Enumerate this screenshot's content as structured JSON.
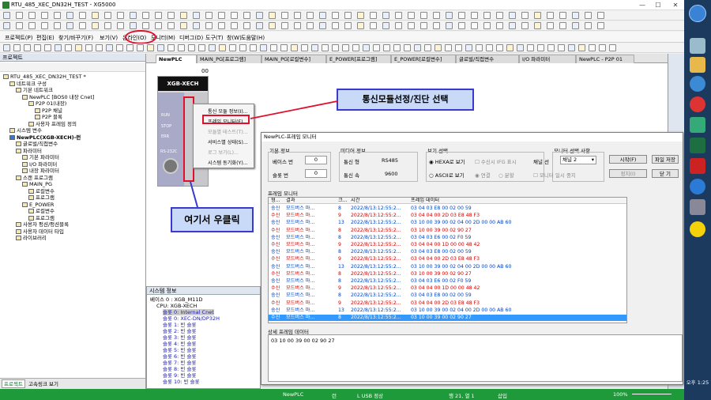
{
  "window": {
    "title": "RTU_485_XEC_DN32H_TEST - XG5000",
    "min": "—",
    "max": "☐",
    "close": "✕"
  },
  "menu": {
    "items": [
      "프로젝트(P)",
      "편집(E)",
      "찾기/바꾸기(F)",
      "보기(V)",
      "온라인(O)",
      "모니터(M)",
      "디버그(D)",
      "도구(T)",
      "창(W)",
      "도움말(H)"
    ]
  },
  "project_panel": {
    "header": "프로젝트",
    "tree": [
      "RTU_485_XEC_DN32H_TEST *",
      "네트워크 구성",
      "기본 네트워크",
      "NewPLC [BOS0 내장 Cnet]",
      "P2P 01(내장)",
      "P2P 채널",
      "P2P 블록",
      "사용자 프레임 정의",
      "시스템 변수",
      "NewPLC(XGB-XECH)-런",
      "글로벌/직접변수",
      "파라미터",
      "기본 파라미터",
      "I/O 파라미터",
      "내장 파라미터",
      "스캔 프로그램",
      "MAIN_PG",
      "로컬변수",
      "프로그램",
      "E_POWER",
      "로컬변수",
      "프로그램",
      "사용자 펑션/펑션블록",
      "사용자 데이터 타입",
      "라이브러리"
    ]
  },
  "bottom_tabs": [
    "프로젝트",
    "고속링크 보기"
  ],
  "editor_tabs": [
    "NewPLC",
    "MAIN_PG[프로그램]",
    "MAIN_PG[로컬변수]",
    "E_POWER[프로그램]",
    "E_POWER[로컬변수]",
    "글로벌/직접변수",
    "I/O 파라미터",
    "NewPLC - P2P 01"
  ],
  "plc": {
    "brand": "XGB-XECH",
    "slot": "00",
    "leds": [
      "RUN",
      "STOP",
      "ERR"
    ],
    "port": "RS-232C"
  },
  "context_menu": [
    "통신 모듈 정보(I)...",
    "프레임 모니터(F)...",
    "모듈별 테스트(T)...",
    "서비스별 상태(S)...",
    "로그 보기(L)...",
    "시스템 동기화(Y)..."
  ],
  "callouts": {
    "top": "통신모듈선정/진단 선택",
    "bottom": "여기서 우클릭"
  },
  "sysinfo": {
    "header": "시스템 정보",
    "items": [
      "베이스 0 : XGB_M11D",
      "CPU: XGB-XECH",
      "슬롯 0: Internal Cnet",
      "슬롯 0: XEC-DN/DP32H",
      "슬롯 1: 빈 슬롯",
      "슬롯 2: 빈 슬롯",
      "슬롯 3: 빈 슬롯",
      "슬롯 4: 빈 슬롯",
      "슬롯 5: 빈 슬롯",
      "슬롯 6: 빈 슬롯",
      "슬롯 7: 빈 슬롯",
      "슬롯 8: 빈 슬롯",
      "슬롯 9: 빈 슬롯",
      "슬롯 10: 빈 슬롯"
    ]
  },
  "dialog": {
    "title": "NewPLC-프레임 모니터",
    "basic_info": {
      "label": "기본 정보",
      "base_label": "베이스 번",
      "base_val": "0",
      "slot_label": "슬롯 번",
      "slot_val": "0"
    },
    "media_info": {
      "label": "미디어 정보",
      "type_label": "통신 형",
      "type_val": "RS485",
      "speed_label": "통신 속",
      "speed_val": "9600"
    },
    "view_select": {
      "label": "보기 선택",
      "hex": "HEXA로 보기",
      "recv_ifg": "수신시 IFG 표시",
      "ascii": "ASCII로 보기",
      "joined": "연결",
      "split": "분할"
    },
    "monitor_select": {
      "label": "모니터 선택 사항",
      "channel_label": "채널 선",
      "channel_val": "채널 2",
      "pause": "모니터 일시 중지"
    },
    "buttons": {
      "start": "시작(F)",
      "save": "파일 저장",
      "stop": "정지(I)",
      "close": "닫 기"
    },
    "frame_monitor_label": "프레임 모니터",
    "columns": [
      "형...",
      "결과",
      "크...",
      "시간",
      "프레임 데이터"
    ],
    "rows": [
      [
        "송신",
        "모드버스 마...",
        "8",
        "2022/8/13:12:55:2...",
        "03 04 03 E8 00 02 00 59"
      ],
      [
        "수신",
        "모드버스 마...",
        "9",
        "2022/8/13:12:55:2...",
        "03 04 04 00 2D 03 E8 48 F3"
      ],
      [
        "송신",
        "모드버스 마...",
        "13",
        "2022/8/13:12:55:2...",
        "03 10 00 39 00 02 04 00 2D 00 00 AB 60"
      ],
      [
        "수신",
        "모드버스 마...",
        "8",
        "2022/8/13:12:55:2...",
        "03 10 00 39 00 02 90 27"
      ],
      [
        "송신",
        "모드버스 마...",
        "8",
        "2022/8/13:12:55:2...",
        "03 04 03 E6 00 02 F0 59"
      ],
      [
        "수신",
        "모드버스 마...",
        "9",
        "2022/8/13:12:55:2...",
        "03 04 04 00 1D 00 00 48 42"
      ],
      [
        "송신",
        "모드버스 마...",
        "8",
        "2022/8/13:12:55:2...",
        "03 04 03 E8 00 02 00 59"
      ],
      [
        "수신",
        "모드버스 마...",
        "9",
        "2022/8/13:12:55:2...",
        "03 04 04 00 2D 03 E8 48 F3"
      ],
      [
        "송신",
        "모드버스 마...",
        "13",
        "2022/8/13:12:55:2...",
        "03 10 00 39 00 02 04 00 2D 00 00 AB 60"
      ],
      [
        "수신",
        "모드버스 마...",
        "8",
        "2022/8/13:12:55:2...",
        "03 10 00 39 00 02 90 27"
      ],
      [
        "송신",
        "모드버스 마...",
        "8",
        "2022/8/13:12:55:2...",
        "03 04 03 E6 00 02 F0 59"
      ],
      [
        "수신",
        "모드버스 마...",
        "9",
        "2022/8/13:12:55:2...",
        "03 04 04 00 1D 00 00 48 42"
      ],
      [
        "송신",
        "모드버스 마...",
        "8",
        "2022/8/13:12:55:2...",
        "03 04 03 E8 00 02 00 59"
      ],
      [
        "수신",
        "모드버스 마...",
        "9",
        "2022/8/13:12:55:2...",
        "03 04 04 00 2D 03 E8 48 F3"
      ],
      [
        "송신",
        "모드버스 마...",
        "13",
        "2022/8/13:12:55:2...",
        "03 10 00 39 00 02 04 00 2D 00 00 AB 60"
      ],
      [
        "수신",
        "모드버스 마...",
        "8",
        "2022/8/13:12:55:2...",
        "03 10 00 39 00 02 90 27"
      ]
    ],
    "detail_label": "상세 프레임 데이터",
    "detail_value": "03 10 00 39 00 02 90 27"
  },
  "status": {
    "plc": "NewPLC",
    "mode": "런",
    "conn": "L USB 정상",
    "pos": "행 21, 열 1",
    "ins": "삽입",
    "zoom": "100%"
  },
  "taskbar": {
    "time": "오후 1:25"
  },
  "colors": {
    "status": "#1f9a3a",
    "highlight_red": "#e0102a",
    "callout_border": "#3a3ad0"
  }
}
